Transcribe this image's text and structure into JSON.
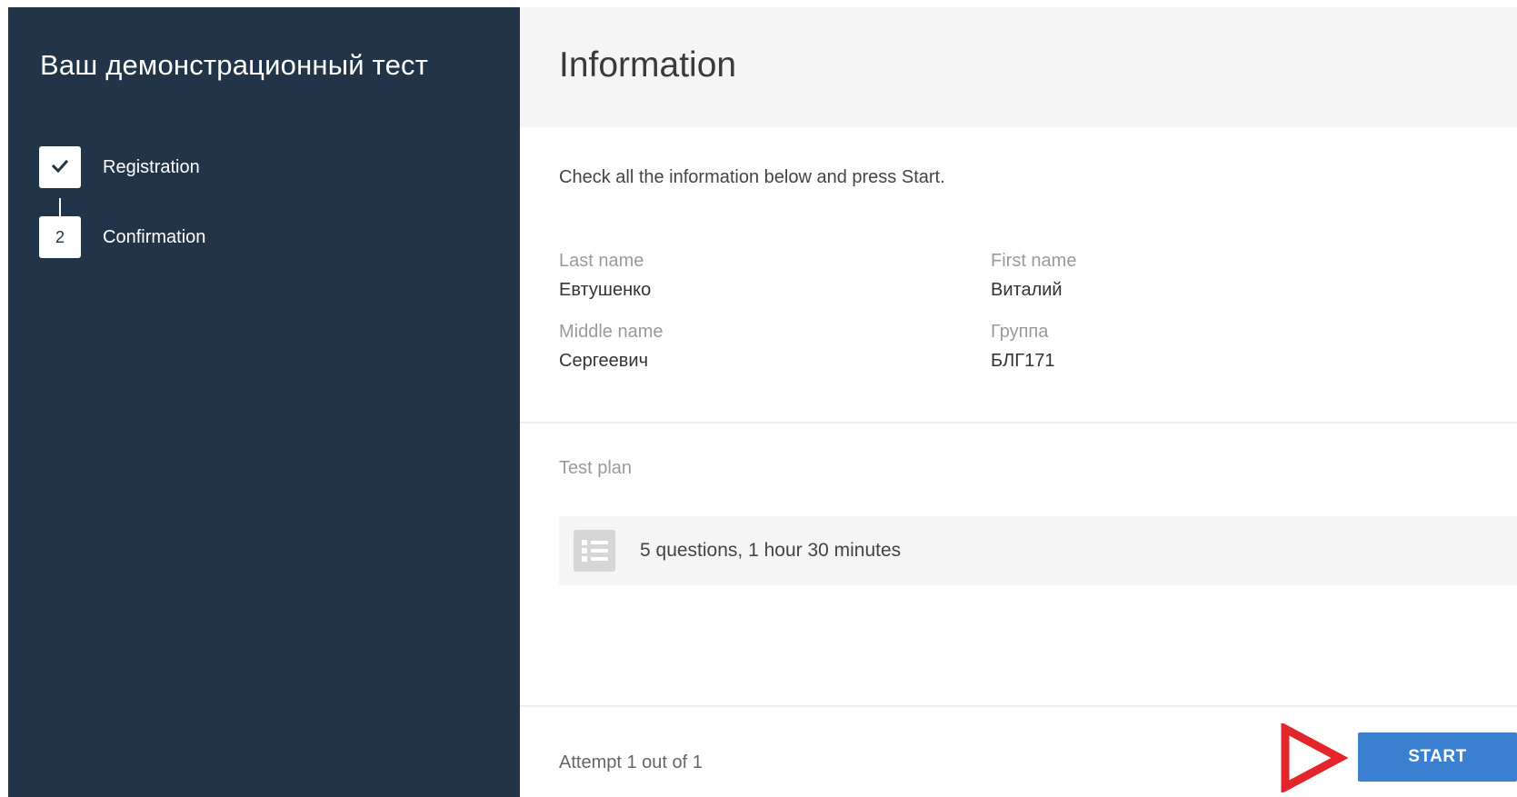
{
  "sidebar": {
    "title": "Ваш демонстрационный тест",
    "steps": [
      {
        "label": "Registration",
        "status": "completed",
        "icon": "check-icon"
      },
      {
        "label": "Confirmation",
        "status": "current",
        "number": "2"
      }
    ]
  },
  "main": {
    "title": "Information",
    "instructions": "Check all the information below and press Start.",
    "fields": {
      "last_name": {
        "label": "Last name",
        "value": "Евтушенко"
      },
      "first_name": {
        "label": "First name",
        "value": "Виталий"
      },
      "middle_name": {
        "label": "Middle name",
        "value": "Сергеевич"
      },
      "group": {
        "label": "Группа",
        "value": "БЛГ171"
      }
    },
    "test_plan": {
      "label": "Test plan",
      "icon": "list-icon",
      "summary": "5 questions, 1 hour 30 minutes"
    },
    "footer": {
      "attempt": "Attempt 1 out of 1",
      "start_label": "START",
      "arrow_icon": "play-arrow-icon"
    }
  },
  "colors": {
    "sidebar_bg": "#213448",
    "header_bg": "#f5f5f5",
    "accent": "#3b7fd0",
    "arrow": "#e3242b"
  }
}
